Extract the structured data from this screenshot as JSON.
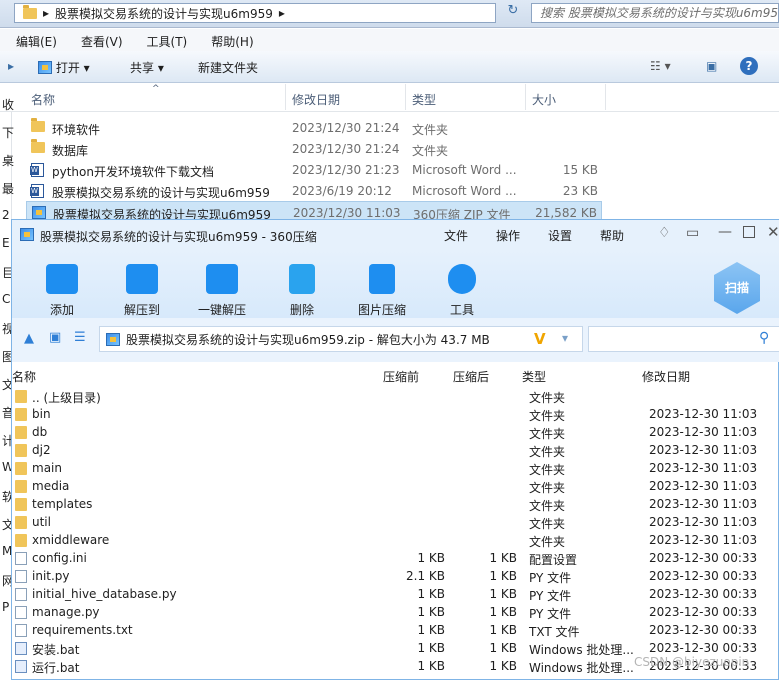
{
  "explorer": {
    "breadcrumb": "股票模拟交易系统的设计与实现u6m959",
    "search_placeholder": "搜索 股票模拟交易系统的设计与实现u6m959",
    "menu": [
      "编辑(E)",
      "查看(V)",
      "工具(T)",
      "帮助(H)"
    ],
    "toolbar": {
      "open": "打开",
      "share": "共享",
      "new_folder": "新建文件夹"
    },
    "columns": {
      "name": "名称",
      "date": "修改日期",
      "type": "类型",
      "size": "大小"
    },
    "files": [
      {
        "name": "环境软件",
        "date": "2023/12/30 21:24",
        "type": "文件夹",
        "size": "",
        "icon": "folder-icon"
      },
      {
        "name": "数据库",
        "date": "2023/12/30 21:24",
        "type": "文件夹",
        "size": "",
        "icon": "folder-icon"
      },
      {
        "name": "python开发环境软件下载文档",
        "date": "2023/12/30 21:23",
        "type": "Microsoft Word ...",
        "size": "15 KB",
        "icon": "word-doc-icon"
      },
      {
        "name": "股票模拟交易系统的设计与实现u6m959",
        "date": "2023/6/19 20:12",
        "type": "Microsoft Word ...",
        "size": "23 KB",
        "icon": "word-doc-icon"
      },
      {
        "name": "股票模拟交易系统的设计与实现u6m959",
        "date": "2023/12/30 11:03",
        "type": "360压缩 ZIP 文件",
        "size": "21,582 KB",
        "icon": "zip-icon"
      }
    ],
    "left_chars": [
      "收",
      "下",
      "桌",
      "最",
      "2",
      "E",
      "巨",
      "C",
      "视",
      "图",
      "文",
      "音",
      "计",
      "W",
      "软",
      "文",
      "M",
      "网",
      "P"
    ]
  },
  "zip": {
    "title": "股票模拟交易系统的设计与实现u6m959 - 360压缩",
    "menu": [
      "文件",
      "操作",
      "设置",
      "帮助"
    ],
    "tools": [
      "添加",
      "解压到",
      "一键解压",
      "删除",
      "图片压缩",
      "工具"
    ],
    "scan_label": "扫描",
    "path": "股票模拟交易系统的设计与实现u6m959.zip - 解包大小为 43.7 MB",
    "columns": {
      "name": "名称",
      "before": "压缩前",
      "after": "压缩后",
      "type": "类型",
      "date": "修改日期"
    },
    "entries": [
      {
        "name": ".. (上级目录)",
        "before": "",
        "after": "",
        "type": "文件夹",
        "date": "",
        "kind": "folder"
      },
      {
        "name": "bin",
        "before": "",
        "after": "",
        "type": "文件夹",
        "date": "2023-12-30 11:03",
        "kind": "folder"
      },
      {
        "name": "db",
        "before": "",
        "after": "",
        "type": "文件夹",
        "date": "2023-12-30 11:03",
        "kind": "folder"
      },
      {
        "name": "dj2",
        "before": "",
        "after": "",
        "type": "文件夹",
        "date": "2023-12-30 11:03",
        "kind": "folder"
      },
      {
        "name": "main",
        "before": "",
        "after": "",
        "type": "文件夹",
        "date": "2023-12-30 11:03",
        "kind": "folder"
      },
      {
        "name": "media",
        "before": "",
        "after": "",
        "type": "文件夹",
        "date": "2023-12-30 11:03",
        "kind": "folder"
      },
      {
        "name": "templates",
        "before": "",
        "after": "",
        "type": "文件夹",
        "date": "2023-12-30 11:03",
        "kind": "folder"
      },
      {
        "name": "util",
        "before": "",
        "after": "",
        "type": "文件夹",
        "date": "2023-12-30 11:03",
        "kind": "folder"
      },
      {
        "name": "xmiddleware",
        "before": "",
        "after": "",
        "type": "文件夹",
        "date": "2023-12-30 11:03",
        "kind": "folder"
      },
      {
        "name": "config.ini",
        "before": "1 KB",
        "after": "1 KB",
        "type": "配置设置",
        "date": "2023-12-30 00:33",
        "kind": "doc"
      },
      {
        "name": "init.py",
        "before": "2.1 KB",
        "after": "1 KB",
        "type": "PY 文件",
        "date": "2023-12-30 00:33",
        "kind": "doc"
      },
      {
        "name": "initial_hive_database.py",
        "before": "1 KB",
        "after": "1 KB",
        "type": "PY 文件",
        "date": "2023-12-30 00:33",
        "kind": "doc"
      },
      {
        "name": "manage.py",
        "before": "1 KB",
        "after": "1 KB",
        "type": "PY 文件",
        "date": "2023-12-30 00:33",
        "kind": "doc"
      },
      {
        "name": "requirements.txt",
        "before": "1 KB",
        "after": "1 KB",
        "type": "TXT 文件",
        "date": "2023-12-30 00:33",
        "kind": "doc"
      },
      {
        "name": "安装.bat",
        "before": "1 KB",
        "after": "1 KB",
        "type": "Windows 批处理...",
        "date": "2023-12-30 00:33",
        "kind": "bat"
      },
      {
        "name": "运行.bat",
        "before": "1 KB",
        "after": "1 KB",
        "type": "Windows 批处理...",
        "date": "2023-12-30 00:33",
        "kind": "bat"
      }
    ]
  },
  "watermark": "CSDN @biyezuopin"
}
